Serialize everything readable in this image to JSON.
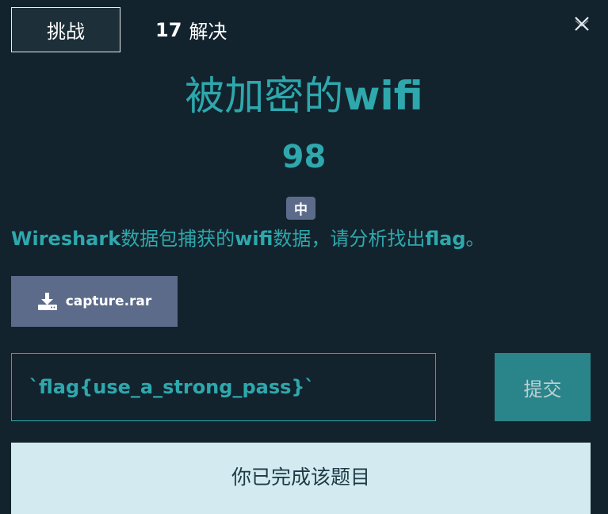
{
  "tabs": {
    "challenge_label": "挑战",
    "solves_count": "17",
    "solves_label": "解决"
  },
  "challenge": {
    "title_cjk": "被加密的",
    "title_latin": "wifi",
    "points": "98",
    "difficulty": "中",
    "description": {
      "part1": "Wireshark",
      "part2": "数据包捕获的",
      "part3": "wifi",
      "part4": "数据，请分析找出",
      "part5": "flag",
      "part6": "。"
    },
    "attachment": "capture.rar"
  },
  "submission": {
    "flag_value": "`flag{use_a_strong_pass}`",
    "submit_label": "提交",
    "completed_message": "你已完成该题目"
  },
  "colors": {
    "background": "#13232d",
    "accent": "#2ea8ad",
    "difficulty_badge": "#5d6b8b",
    "submit": "#2a858b",
    "completed_banner": "#d3ebf0"
  },
  "icons": {
    "close": "close-icon",
    "download": "download-icon"
  }
}
